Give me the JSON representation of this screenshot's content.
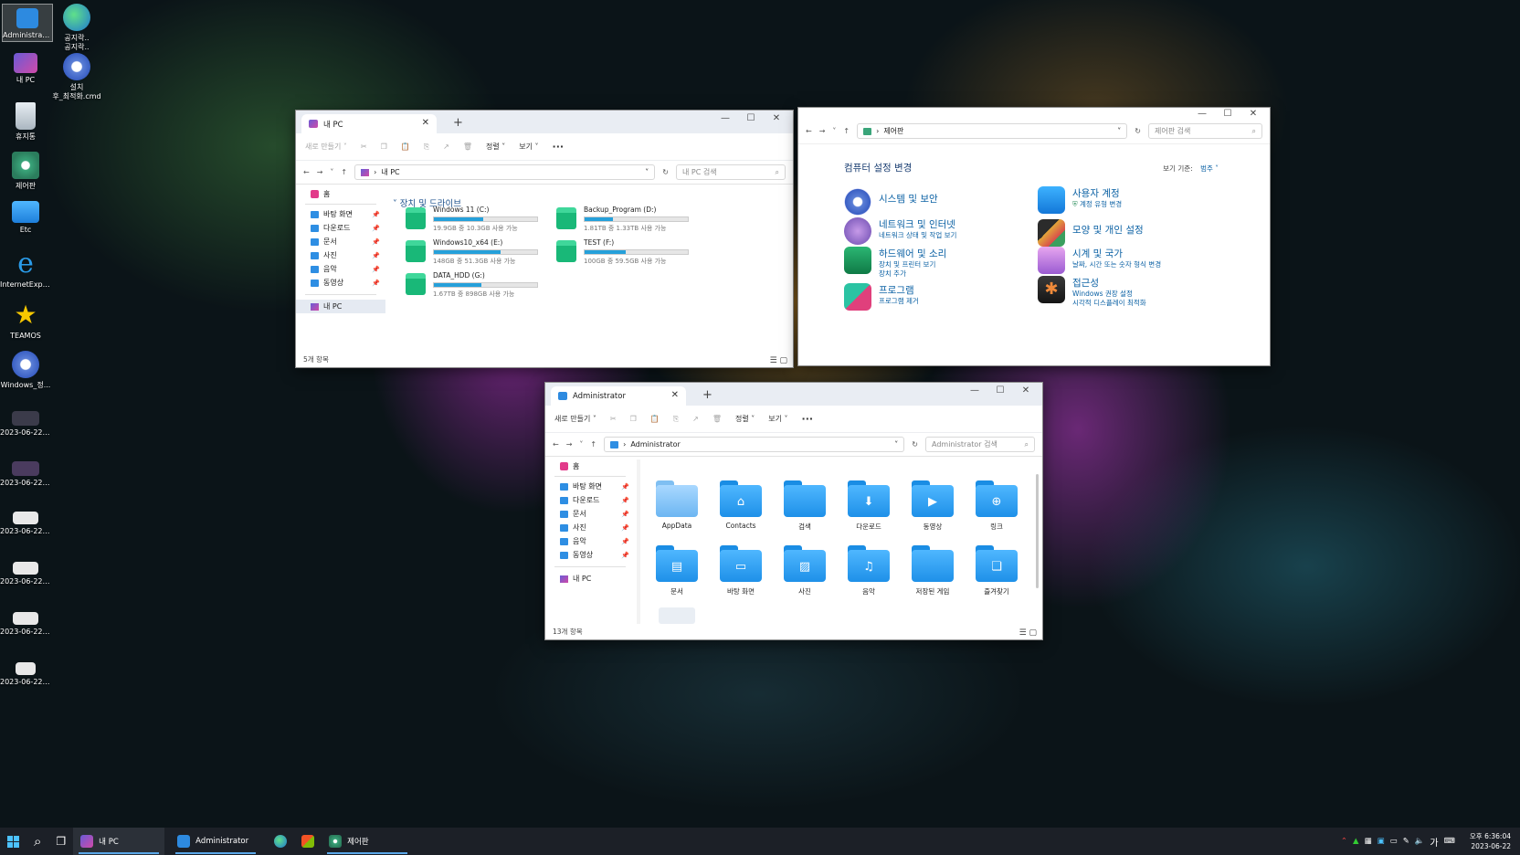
{
  "desktop": {
    "icons": [
      {
        "label": "Administrator"
      },
      {
        "label": "공지락..\n공지락.."
      },
      {
        "label": "내 PC"
      },
      {
        "label": "설치\n후_최적화.cmd"
      },
      {
        "label": "휴지통"
      },
      {
        "label": "제어판"
      },
      {
        "label": "Etc"
      },
      {
        "label": "InternetExplor..."
      },
      {
        "label": "TEAMOS"
      },
      {
        "label": "Windows_정..."
      },
      {
        "label": "2023-06-22_..."
      },
      {
        "label": "2023-06-22_..."
      },
      {
        "label": "2023-06-22_..."
      },
      {
        "label": "2023-06-22_..."
      },
      {
        "label": "2023-06-22_..."
      },
      {
        "label": "2023-06-22_..."
      }
    ]
  },
  "mypc": {
    "tab_title": "내 PC",
    "new_tab": "+",
    "toolbar": {
      "new": "새로 만들기 ˅",
      "sort": "정렬 ˅",
      "view": "보기 ˅",
      "more": "···"
    },
    "address": "내 PC",
    "search_placeholder": "내 PC 검색",
    "nav": {
      "home": "홈",
      "desktop": "바탕 화면",
      "downloads": "다운로드",
      "documents": "문서",
      "pictures": "사진",
      "music": "음악",
      "videos": "동영상",
      "thispc": "내 PC"
    },
    "section_title": "장치 및 드라이브",
    "drives": [
      {
        "name": "Windows 11 (C:)",
        "info": "19.9GB 중 10.3GB 사용 가능",
        "used": 0.48
      },
      {
        "name": "Backup_Program (D:)",
        "info": "1.81TB 중 1.33TB 사용 가능",
        "used": 0.27
      },
      {
        "name": "Windows10_x64 (E:)",
        "info": "148GB 중 51.3GB 사용 가능",
        "used": 0.65
      },
      {
        "name": "TEST (F:)",
        "info": "100GB 중 59.5GB 사용 가능",
        "used": 0.4
      },
      {
        "name": "DATA_HDD (G:)",
        "info": "1.67TB 중 898GB 사용 가능",
        "used": 0.46
      }
    ],
    "status": "5개 항목"
  },
  "control_panel": {
    "address": "제어판",
    "search_placeholder": "제어판 검색",
    "heading": "컴퓨터 설정 변경",
    "view_by_label": "보기 기준:",
    "view_by_value": "범주 ˅",
    "categories": [
      {
        "title": "시스템 및 보안",
        "subs": []
      },
      {
        "title": "네트워크 및 인터넷",
        "subs": [
          "네트워크 상태 및 작업 보기"
        ]
      },
      {
        "title": "하드웨어 및 소리",
        "subs": [
          "장치 및 프린터 보기",
          "장치 추가"
        ]
      },
      {
        "title": "프로그램",
        "subs": [
          "프로그램 제거"
        ]
      },
      {
        "title": "사용자 계정",
        "subs": [
          "계정 유형 변경"
        ]
      },
      {
        "title": "모양 및 개인 설정",
        "subs": []
      },
      {
        "title": "시계 및 국가",
        "subs": [
          "날짜, 시간 또는 숫자 형식 변경"
        ]
      },
      {
        "title": "접근성",
        "subs": [
          "Windows 권장 설정",
          "시각적 디스플레이 최적화"
        ]
      }
    ]
  },
  "admin": {
    "tab_title": "Administrator",
    "new_tab": "+",
    "toolbar": {
      "new": "새로 만들기 ˅",
      "sort": "정렬 ˅",
      "view": "보기 ˅",
      "more": "···"
    },
    "address": "Administrator",
    "search_placeholder": "Administrator 검색",
    "nav": {
      "home": "홈",
      "desktop": "바탕 화면",
      "downloads": "다운로드",
      "documents": "문서",
      "pictures": "사진",
      "music": "음악",
      "videos": "동영상",
      "thispc": "내 PC"
    },
    "folders": [
      "AppData",
      "Contacts",
      "검색",
      "다운로드",
      "동영상",
      "링크",
      "문서",
      "바탕 화면",
      "사진",
      "음악",
      "저장된 게임",
      "즐겨찾기"
    ],
    "status": "13개 항목"
  },
  "taskbar": {
    "apps": [
      {
        "label": "내 PC"
      },
      {
        "label": "Administrator"
      },
      {
        "label": "제어판"
      }
    ],
    "ime": "가",
    "time": "오후 6:36:04",
    "date": "2023-06-22"
  },
  "colors": {
    "accent": "#0b61a4",
    "folder": "#2b9af0",
    "drive_bar": "#26a0da",
    "taskbar": "#1c2027"
  }
}
